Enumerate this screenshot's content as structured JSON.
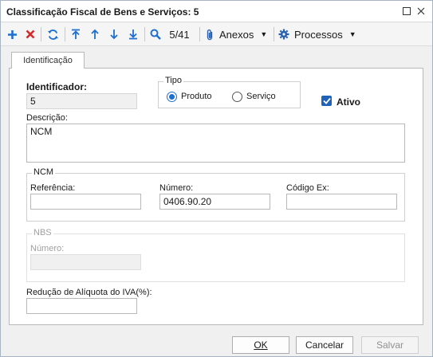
{
  "window": {
    "title": "Classificação Fiscal de Bens e Serviços: 5"
  },
  "toolbar": {
    "record_counter": "5/41",
    "anexos_label": "Anexos",
    "processos_label": "Processos"
  },
  "tabs": [
    {
      "label": "Identificação",
      "active": true
    }
  ],
  "form": {
    "identificador": {
      "label": "Identificador:",
      "value": "5"
    },
    "tipo": {
      "label": "Tipo",
      "options": [
        {
          "label": "Produto",
          "selected": true
        },
        {
          "label": "Serviço",
          "selected": false
        }
      ]
    },
    "ativo": {
      "label": "Ativo",
      "checked": true
    },
    "descricao": {
      "label": "Descrição:",
      "value": "NCM"
    },
    "ncm": {
      "title": "NCM",
      "referencia": {
        "label": "Referência:",
        "value": ""
      },
      "numero": {
        "label": "Número:",
        "value": "0406.90.20"
      },
      "codigo_ex": {
        "label": "Código Ex:",
        "value": ""
      }
    },
    "nbs": {
      "title": "NBS",
      "numero": {
        "label": "Número:",
        "value": ""
      }
    },
    "reducao": {
      "label": "Redução de Alíquota do IVA(%):",
      "value": ""
    }
  },
  "footer": {
    "ok_label": "OK",
    "cancelar_label": "Cancelar",
    "salvar_label": "Salvar"
  },
  "colors": {
    "accent_blue": "#1e6fd0",
    "delete_red": "#d42a2a"
  }
}
